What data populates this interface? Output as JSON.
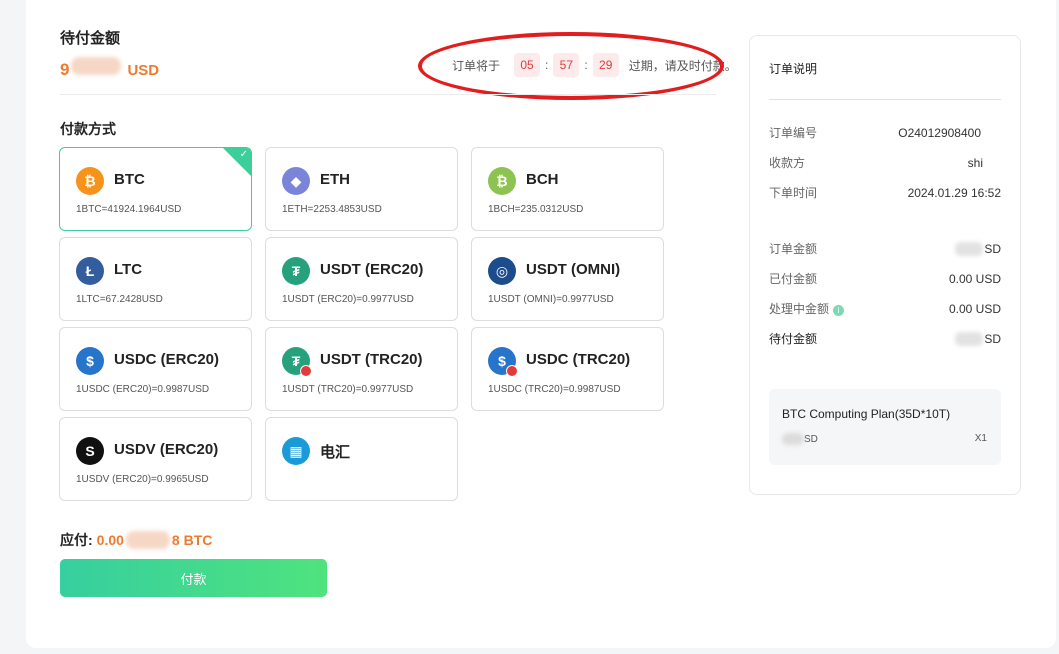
{
  "header": {
    "due_label": "待付金额",
    "due_amount_prefix": "9",
    "due_currency": "USD",
    "countdown_prefix": "订单将于",
    "countdown_hours": "05",
    "countdown_minutes": "57",
    "countdown_seconds": "29",
    "countdown_suffix": "过期，请及时付款。"
  },
  "methods_title": "付款方式",
  "methods": [
    {
      "name": "BTC",
      "rate": "1BTC=41924.1964USD",
      "icon": "bitcoin-icon",
      "color": "#f7931a",
      "glyph": "₿",
      "selected": true
    },
    {
      "name": "ETH",
      "rate": "1ETH=2253.4853USD",
      "icon": "ethereum-icon",
      "color": "#7a85d9",
      "glyph": "◆",
      "selected": false
    },
    {
      "name": "BCH",
      "rate": "1BCH=235.0312USD",
      "icon": "bitcoin-cash-icon",
      "color": "#8dc351",
      "glyph": "₿",
      "selected": false
    },
    {
      "name": "LTC",
      "rate": "1LTC=67.2428USD",
      "icon": "litecoin-icon",
      "color": "#345d9d",
      "glyph": "Ł",
      "selected": false
    },
    {
      "name": "USDT (ERC20)",
      "rate": "1USDT (ERC20)=0.9977USD",
      "icon": "tether-icon",
      "color": "#26a17b",
      "glyph": "₮",
      "selected": false
    },
    {
      "name": "USDT (OMNI)",
      "rate": "1USDT (OMNI)=0.9977USD",
      "icon": "omni-icon",
      "color": "#1c4c8c",
      "glyph": "◎",
      "selected": false
    },
    {
      "name": "USDC (ERC20)",
      "rate": "1USDC (ERC20)=0.9987USD",
      "icon": "usdc-icon",
      "color": "#2775ca",
      "glyph": "$",
      "selected": false
    },
    {
      "name": "USDT (TRC20)",
      "rate": "1USDT (TRC20)=0.9977USD",
      "icon": "tether-tron-icon",
      "color": "#26a17b",
      "glyph": "₮",
      "selected": false,
      "badge": true
    },
    {
      "name": "USDC (TRC20)",
      "rate": "1USDC (TRC20)=0.9987USD",
      "icon": "usdc-tron-icon",
      "color": "#2775ca",
      "glyph": "$",
      "selected": false,
      "badge": true
    },
    {
      "name": "USDV (ERC20)",
      "rate": "1USDV (ERC20)=0.9965USD",
      "icon": "usdv-icon",
      "color": "#111111",
      "glyph": "S",
      "selected": false
    },
    {
      "name": "电汇",
      "rate": "",
      "icon": "bank-transfer-icon",
      "color": "#1a9bd7",
      "glyph": "▦",
      "selected": false
    }
  ],
  "payment": {
    "label": "应付:",
    "amount_prefix": "0.00",
    "amount_suffix": "8 BTC",
    "button": "付款"
  },
  "summary": {
    "title": "订单说明",
    "order_no_label": "订单编号",
    "order_no_value": "O24012908400",
    "payee_label": "收款方",
    "payee_value": "shi",
    "time_label": "下单时间",
    "time_value": "2024.01.29 16:52",
    "order_amount_label": "订单金额",
    "order_amount_value": "SD",
    "paid_label": "已付金额",
    "paid_value": "0.00 USD",
    "processing_label": "处理中金额",
    "processing_value": "0.00 USD",
    "due_label": "待付金额",
    "due_value": "SD",
    "plan_name": "BTC Computing Plan(35D*10T)",
    "plan_price": "SD",
    "plan_qty": "X1"
  }
}
